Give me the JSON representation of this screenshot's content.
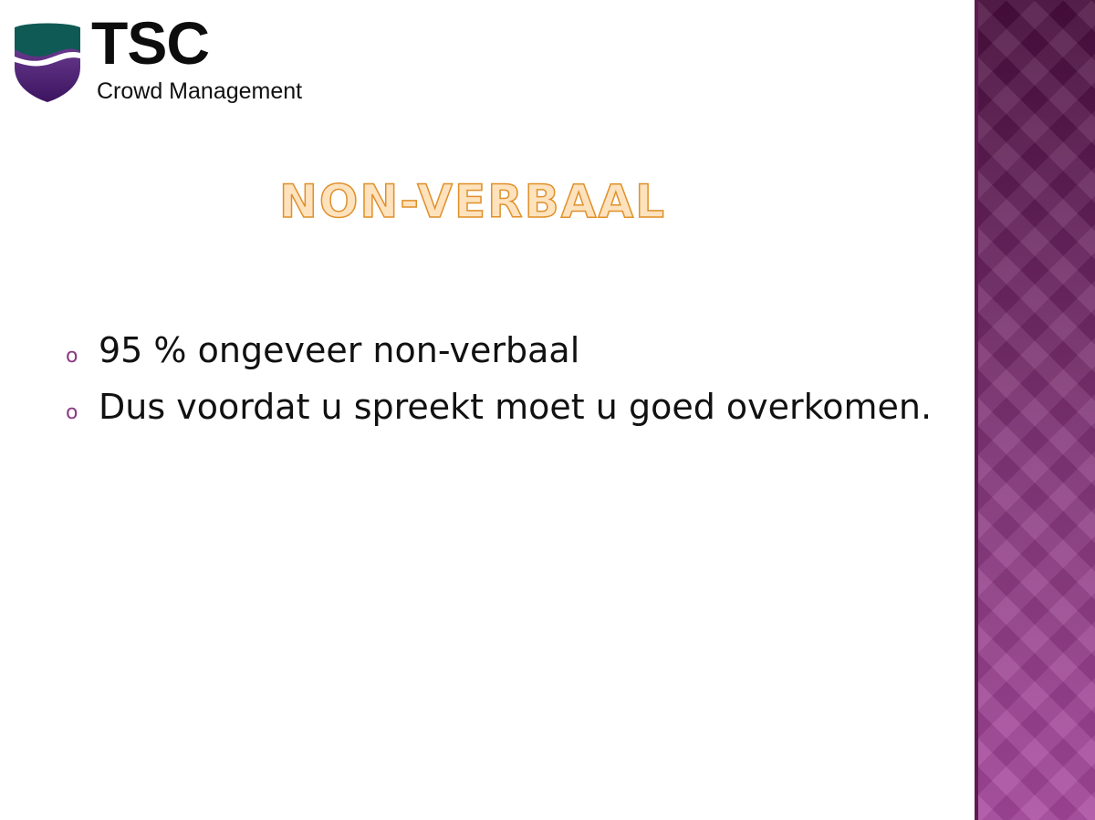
{
  "logo": {
    "name": "TSC",
    "subtitle": "Crowd Management",
    "colors": {
      "teal": "#0f5a55",
      "purple": "#4e1e6e"
    }
  },
  "slide": {
    "title": "Non-verbaal",
    "title_display": "NON-VERBAAL",
    "bullets": [
      {
        "marker": "o",
        "text": "95 % ongeveer non-verbaal"
      },
      {
        "marker": "o",
        "text": "Dus voordat u spreekt moet u goed overkomen."
      }
    ]
  },
  "theme": {
    "accent": "#8a3a80",
    "title_fill": "#fde2bd",
    "title_outline": "#e0902a",
    "side_band": "#6a2460"
  }
}
